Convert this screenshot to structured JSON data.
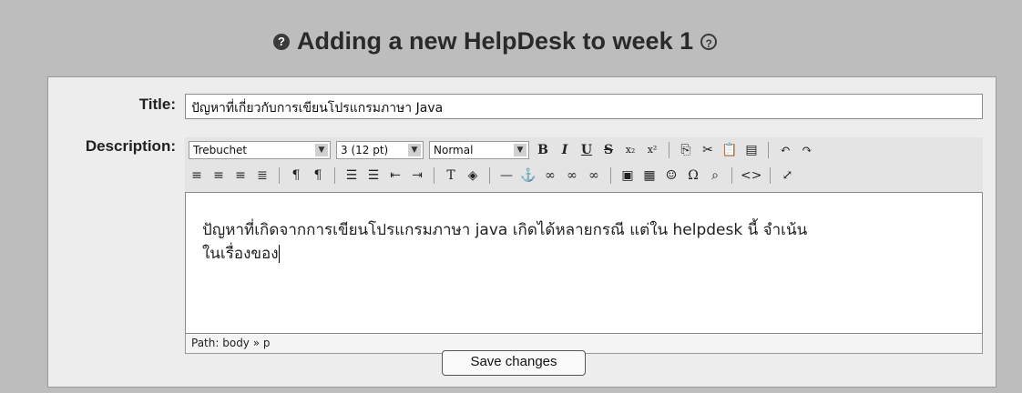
{
  "heading": {
    "text": "Adding a new HelpDesk to week 1"
  },
  "form": {
    "title_label": "Title:",
    "title_value": "ปัญหาที่เกี่ยวกับการเขียนโปรแกรมภาษา Java",
    "description_label": "Description:",
    "editor": {
      "font_family": "Trebuchet",
      "font_size": "3 (12 pt)",
      "format": "Normal",
      "content_line1": "ปัญหาที่เกิดจากการเขียนโปรแกรมภาษา java เกิดได้หลายกรณี แต่ใน helpdesk นี้ จำเน้น",
      "content_line2": "ในเรื่องของ",
      "path_label": "Path:",
      "path_value": "body » p"
    },
    "save_label": "Save changes"
  },
  "toolbar_icons": {
    "row1": [
      "bold-icon",
      "italic-icon",
      "underline-icon",
      "strikethrough-icon",
      "subscript-icon",
      "superscript-icon",
      "copy-icon",
      "cut-icon",
      "paste-icon",
      "paste-word-icon",
      "undo-icon",
      "redo-icon"
    ],
    "row2": [
      "align-left-icon",
      "align-center-icon",
      "align-right-icon",
      "justify-icon",
      "ltr-icon",
      "rtl-icon",
      "ordered-list-icon",
      "unordered-list-icon",
      "outdent-icon",
      "indent-icon",
      "text-color-icon",
      "bg-color-icon",
      "hr-icon",
      "anchor-icon",
      "link-icon",
      "unlink-icon",
      "nolink-icon",
      "image-icon",
      "table-icon",
      "smiley-icon",
      "special-char-icon",
      "search-replace-icon",
      "html-source-icon",
      "fullscreen-icon"
    ]
  }
}
